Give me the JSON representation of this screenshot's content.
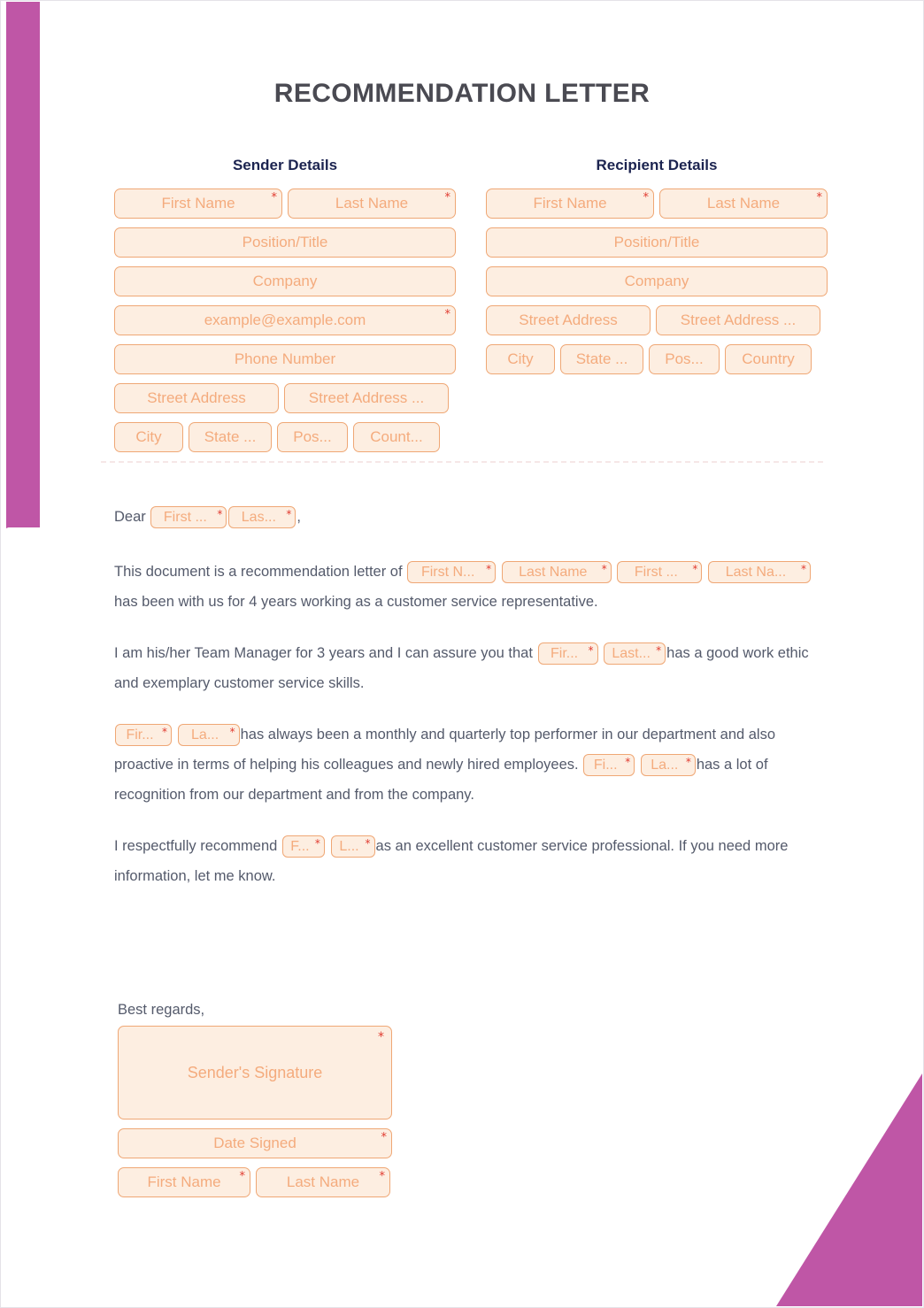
{
  "document": {
    "title": "RECOMMENDATION LETTER",
    "accent_purple": "#bf56a6",
    "field_fill": "#fdeee1",
    "field_border": "#efa775",
    "placeholder_color": "#f4ab7d",
    "required_marker": "*",
    "heading_color": "#1c2450",
    "body_text_color": "#545a6b"
  },
  "sender": {
    "heading": "Sender Details",
    "fields": {
      "first_name": "First Name",
      "last_name": "Last Name",
      "position_title": "Position/Title",
      "company": "Company",
      "email": "example@example.com",
      "phone": "Phone Number",
      "street_address": "Street Address",
      "street_address_2": "Street Address ...",
      "city": "City",
      "state": "State ...",
      "postal": "Pos...",
      "country": "Count..."
    }
  },
  "recipient": {
    "heading": "Recipient Details",
    "fields": {
      "first_name": "First Name",
      "last_name": "Last Name",
      "position_title": "Position/Title",
      "company": "Company",
      "street_address": "Street Address",
      "street_address_2": "Street Address ...",
      "city": "City",
      "state": "State ...",
      "postal": "Pos...",
      "country": "Country"
    }
  },
  "letter": {
    "salutation": {
      "label": "Dear",
      "first": "First ...",
      "last": "Las...",
      "comma": ","
    },
    "p1": {
      "text_a": "This document is a recommendation letter of",
      "first_a": "First N...",
      "last_a": "Last Name",
      "first_b": "First ...",
      "last_b": "Last Na...",
      "text_b": "has been with us for 4 years working as a customer service representative."
    },
    "p2": {
      "text_a": "I am his/her Team Manager for 3 years and I can assure you that",
      "first": "Fir...",
      "last": "Last...",
      "text_b": "has a good work ethic and exemplary customer service skills."
    },
    "p3": {
      "first_a": "Fir...",
      "last_a": "La...",
      "text_a": "has always been a monthly and quarterly top performer in our department and also proactive in terms of helping his colleagues and newly hired employees.",
      "first_b": "Fi...",
      "last_b": "La...",
      "text_b": "has a lot of recognition from our department and from the company."
    },
    "p4": {
      "text_a": "I respectfully recommend",
      "first": "F...",
      "last": "L...",
      "text_b": "as an excellent customer service professional. If you need more information, let me know."
    },
    "closing": "Best regards,"
  },
  "signature": {
    "signature_placeholder": "Sender's Signature",
    "date_signed": "Date Signed",
    "first_name": "First Name",
    "last_name": "Last Name"
  }
}
